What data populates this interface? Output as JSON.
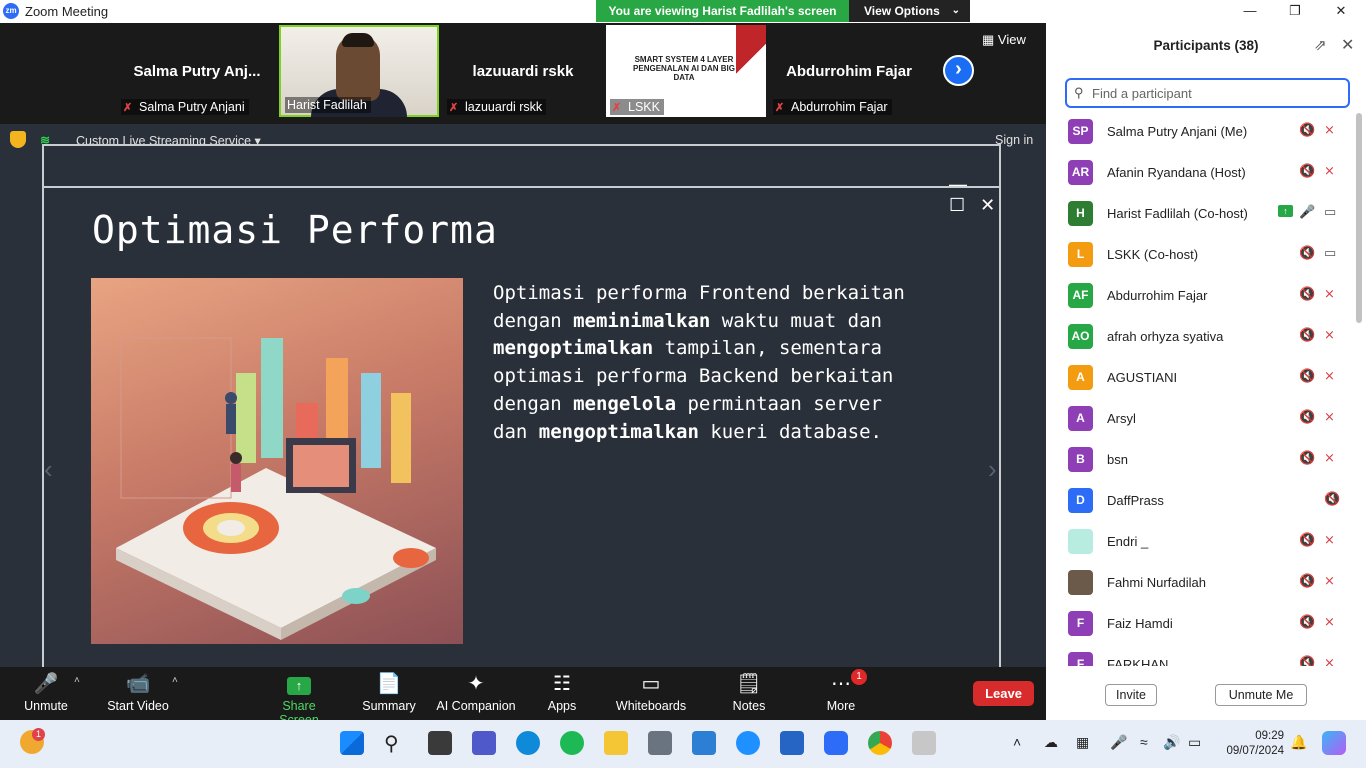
{
  "window": {
    "title": "Zoom Meeting",
    "logo": "zm",
    "viewing_banner": "You are viewing Harist Fadlilah's screen",
    "view_options": "View Options"
  },
  "gallery": {
    "view_label": "View",
    "tiles": [
      {
        "name": "Salma Putry Anj...",
        "label": "Salma Putry Anjani",
        "muted": true
      },
      {
        "name": "",
        "label": "Harist Fadlilah",
        "muted": false
      },
      {
        "name": "lazuuardi rskk",
        "label": "lazuuardi rskk",
        "muted": true
      },
      {
        "name": "",
        "label": "LSKK",
        "muted": true
      },
      {
        "name": "Abdurrohim Fajar",
        "label": "Abdurrohim Fajar",
        "muted": true
      }
    ],
    "lskk_slide_title": "SMART SYSTEM 4 LAYER PENGENALAN AI DAN BIG DATA"
  },
  "share": {
    "stream_label": "Custom Live Streaming Service",
    "signin": "Sign in",
    "slide_title": "Optimasi Performa",
    "slide_text": [
      {
        "t": "Optimasi performa Frontend berkaitan",
        "b": false
      },
      {
        "t": "dengan ",
        "b": false
      },
      {
        "t": "meminimalkan",
        "b": true
      },
      {
        "t": " waktu muat dan",
        "b": false
      },
      {
        "t": "mengoptimalkan",
        "b": true
      },
      {
        "t": " tampilan, sementara",
        "b": false
      },
      {
        "t": "optimasi performa Backend berkaitan",
        "b": false
      },
      {
        "t": "dengan ",
        "b": false
      },
      {
        "t": "mengelola",
        "b": true
      },
      {
        "t": " permintaan server",
        "b": false
      },
      {
        "t": "dan ",
        "b": false
      },
      {
        "t": "mengoptimalkan",
        "b": true
      },
      {
        "t": " kueri database.",
        "b": false
      }
    ]
  },
  "toolbar": {
    "unmute": "Unmute",
    "start_video": "Start Video",
    "share_screen": "Share Screen",
    "summary": "Summary",
    "ai_companion": "AI Companion",
    "apps": "Apps",
    "whiteboards": "Whiteboards",
    "notes": "Notes",
    "more": "More",
    "more_badge": "1",
    "leave": "Leave"
  },
  "participants": {
    "title": "Participants (38)",
    "search_placeholder": "Find a participant",
    "invite": "Invite",
    "unmute_me": "Unmute Me",
    "items": [
      {
        "initials": "SP",
        "name": "Salma Putry Anjani (Me)",
        "color": "#8e3fb5"
      },
      {
        "initials": "AR",
        "name": "Afanin Ryandana (Host)",
        "color": "#8e3fb5"
      },
      {
        "initials": "H",
        "name": "Harist Fadlilah (Co-host)",
        "color": "#2e7d32"
      },
      {
        "initials": "L",
        "name": "LSKK (Co-host)",
        "color": "#f39c12"
      },
      {
        "initials": "AF",
        "name": "Abdurrohim Fajar",
        "color": "#27a745"
      },
      {
        "initials": "AO",
        "name": "afrah orhyza syativa",
        "color": "#27a745"
      },
      {
        "initials": "A",
        "name": "AGUSTIANI",
        "color": "#f39c12"
      },
      {
        "initials": "A",
        "name": "Arsyl",
        "color": "#8e3fb5"
      },
      {
        "initials": "B",
        "name": "bsn",
        "color": "#8e3fb5"
      },
      {
        "initials": "D",
        "name": "DaffPrass",
        "color": "#2d6cf6"
      },
      {
        "initials": "",
        "name": "Endri _",
        "color": "#b8ece0"
      },
      {
        "initials": "",
        "name": "Fahmi Nurfadilah",
        "color": "#6b5a4a"
      },
      {
        "initials": "F",
        "name": "Faiz Hamdi",
        "color": "#8e3fb5"
      },
      {
        "initials": "F",
        "name": "FARKHAN",
        "color": "#8e3fb5"
      }
    ]
  },
  "taskbar": {
    "time": "09:29",
    "date": "09/07/2024",
    "weather_badge": "1"
  }
}
